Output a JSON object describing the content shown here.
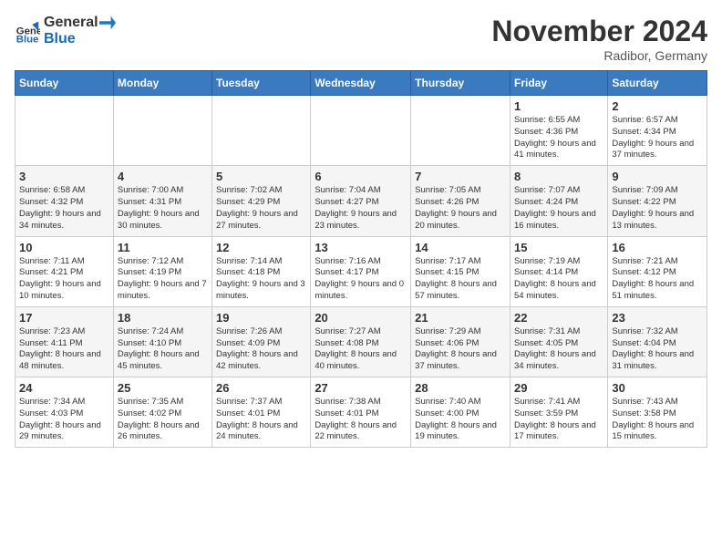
{
  "logo": {
    "text_general": "General",
    "text_blue": "Blue"
  },
  "title": {
    "month": "November 2024",
    "location": "Radibor, Germany"
  },
  "weekdays": [
    "Sunday",
    "Monday",
    "Tuesday",
    "Wednesday",
    "Thursday",
    "Friday",
    "Saturday"
  ],
  "weeks": [
    [
      {
        "day": "",
        "info": ""
      },
      {
        "day": "",
        "info": ""
      },
      {
        "day": "",
        "info": ""
      },
      {
        "day": "",
        "info": ""
      },
      {
        "day": "",
        "info": ""
      },
      {
        "day": "1",
        "info": "Sunrise: 6:55 AM\nSunset: 4:36 PM\nDaylight: 9 hours and 41 minutes."
      },
      {
        "day": "2",
        "info": "Sunrise: 6:57 AM\nSunset: 4:34 PM\nDaylight: 9 hours and 37 minutes."
      }
    ],
    [
      {
        "day": "3",
        "info": "Sunrise: 6:58 AM\nSunset: 4:32 PM\nDaylight: 9 hours and 34 minutes."
      },
      {
        "day": "4",
        "info": "Sunrise: 7:00 AM\nSunset: 4:31 PM\nDaylight: 9 hours and 30 minutes."
      },
      {
        "day": "5",
        "info": "Sunrise: 7:02 AM\nSunset: 4:29 PM\nDaylight: 9 hours and 27 minutes."
      },
      {
        "day": "6",
        "info": "Sunrise: 7:04 AM\nSunset: 4:27 PM\nDaylight: 9 hours and 23 minutes."
      },
      {
        "day": "7",
        "info": "Sunrise: 7:05 AM\nSunset: 4:26 PM\nDaylight: 9 hours and 20 minutes."
      },
      {
        "day": "8",
        "info": "Sunrise: 7:07 AM\nSunset: 4:24 PM\nDaylight: 9 hours and 16 minutes."
      },
      {
        "day": "9",
        "info": "Sunrise: 7:09 AM\nSunset: 4:22 PM\nDaylight: 9 hours and 13 minutes."
      }
    ],
    [
      {
        "day": "10",
        "info": "Sunrise: 7:11 AM\nSunset: 4:21 PM\nDaylight: 9 hours and 10 minutes."
      },
      {
        "day": "11",
        "info": "Sunrise: 7:12 AM\nSunset: 4:19 PM\nDaylight: 9 hours and 7 minutes."
      },
      {
        "day": "12",
        "info": "Sunrise: 7:14 AM\nSunset: 4:18 PM\nDaylight: 9 hours and 3 minutes."
      },
      {
        "day": "13",
        "info": "Sunrise: 7:16 AM\nSunset: 4:17 PM\nDaylight: 9 hours and 0 minutes."
      },
      {
        "day": "14",
        "info": "Sunrise: 7:17 AM\nSunset: 4:15 PM\nDaylight: 8 hours and 57 minutes."
      },
      {
        "day": "15",
        "info": "Sunrise: 7:19 AM\nSunset: 4:14 PM\nDaylight: 8 hours and 54 minutes."
      },
      {
        "day": "16",
        "info": "Sunrise: 7:21 AM\nSunset: 4:12 PM\nDaylight: 8 hours and 51 minutes."
      }
    ],
    [
      {
        "day": "17",
        "info": "Sunrise: 7:23 AM\nSunset: 4:11 PM\nDaylight: 8 hours and 48 minutes."
      },
      {
        "day": "18",
        "info": "Sunrise: 7:24 AM\nSunset: 4:10 PM\nDaylight: 8 hours and 45 minutes."
      },
      {
        "day": "19",
        "info": "Sunrise: 7:26 AM\nSunset: 4:09 PM\nDaylight: 8 hours and 42 minutes."
      },
      {
        "day": "20",
        "info": "Sunrise: 7:27 AM\nSunset: 4:08 PM\nDaylight: 8 hours and 40 minutes."
      },
      {
        "day": "21",
        "info": "Sunrise: 7:29 AM\nSunset: 4:06 PM\nDaylight: 8 hours and 37 minutes."
      },
      {
        "day": "22",
        "info": "Sunrise: 7:31 AM\nSunset: 4:05 PM\nDaylight: 8 hours and 34 minutes."
      },
      {
        "day": "23",
        "info": "Sunrise: 7:32 AM\nSunset: 4:04 PM\nDaylight: 8 hours and 31 minutes."
      }
    ],
    [
      {
        "day": "24",
        "info": "Sunrise: 7:34 AM\nSunset: 4:03 PM\nDaylight: 8 hours and 29 minutes."
      },
      {
        "day": "25",
        "info": "Sunrise: 7:35 AM\nSunset: 4:02 PM\nDaylight: 8 hours and 26 minutes."
      },
      {
        "day": "26",
        "info": "Sunrise: 7:37 AM\nSunset: 4:01 PM\nDaylight: 8 hours and 24 minutes."
      },
      {
        "day": "27",
        "info": "Sunrise: 7:38 AM\nSunset: 4:01 PM\nDaylight: 8 hours and 22 minutes."
      },
      {
        "day": "28",
        "info": "Sunrise: 7:40 AM\nSunset: 4:00 PM\nDaylight: 8 hours and 19 minutes."
      },
      {
        "day": "29",
        "info": "Sunrise: 7:41 AM\nSunset: 3:59 PM\nDaylight: 8 hours and 17 minutes."
      },
      {
        "day": "30",
        "info": "Sunrise: 7:43 AM\nSunset: 3:58 PM\nDaylight: 8 hours and 15 minutes."
      }
    ]
  ]
}
